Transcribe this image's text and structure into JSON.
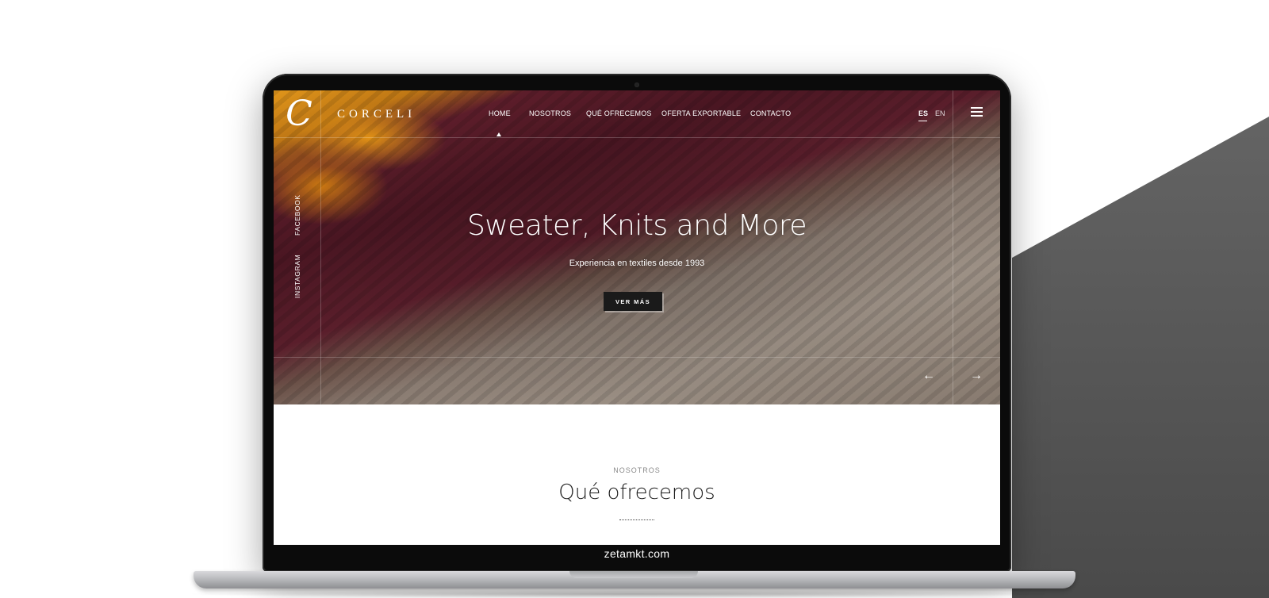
{
  "brand": {
    "logo_glyph": "C",
    "name": "CORCELI"
  },
  "nav": {
    "items": [
      {
        "label": "HOME",
        "active": true
      },
      {
        "label": "NOSOTROS"
      },
      {
        "label": "QUÉ OFRECEMOS"
      },
      {
        "label": "OFERTA EXPORTABLE"
      },
      {
        "label": "CONTACTO"
      }
    ]
  },
  "lang": {
    "es": "ES",
    "en": "EN",
    "active": "ES"
  },
  "social": {
    "facebook": "FACEBOOK",
    "instagram": "INSTAGRAM"
  },
  "hero": {
    "title": "Sweater, Knits and More",
    "subtitle": "Experiencia en textiles desde 1993",
    "button": "VER MÁS",
    "prev_arrow": "←",
    "next_arrow": "→"
  },
  "section": {
    "eyebrow": "NOSOTROS",
    "title": "Qué ofrecemos"
  },
  "device": {
    "chin_text": "zetamkt.com"
  },
  "colors": {
    "accent_orange": "#e0951a",
    "accent_wine": "#4a1622",
    "button_dark": "#1a1a1a",
    "backdrop_gray": "#5a5a5a"
  }
}
